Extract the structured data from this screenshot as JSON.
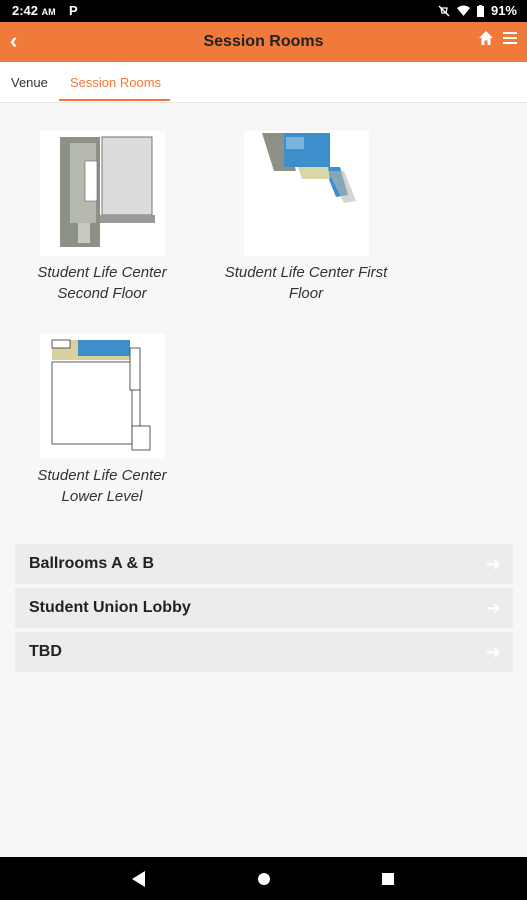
{
  "statusbar": {
    "time": "2:42",
    "ampm": "AM",
    "notif": "P",
    "battery": "91%"
  },
  "appbar": {
    "title": "Session Rooms"
  },
  "tabs": [
    {
      "label": "Venue"
    },
    {
      "label": "Session Rooms"
    }
  ],
  "maps": [
    {
      "caption_line1": "Student Life Center",
      "caption_line2": "Second Floor"
    },
    {
      "caption_line1": "Student Life Center First",
      "caption_line2": "Floor"
    },
    {
      "caption_line1": "Student Life Center",
      "caption_line2": "Lower Level"
    }
  ],
  "rooms": [
    {
      "label": "Ballrooms A & B"
    },
    {
      "label": "Student Union Lobby"
    },
    {
      "label": "TBD"
    }
  ],
  "colors": {
    "accent": "#f07a3a",
    "row_bg": "#ececec",
    "page_bg": "#f7f7f7"
  }
}
